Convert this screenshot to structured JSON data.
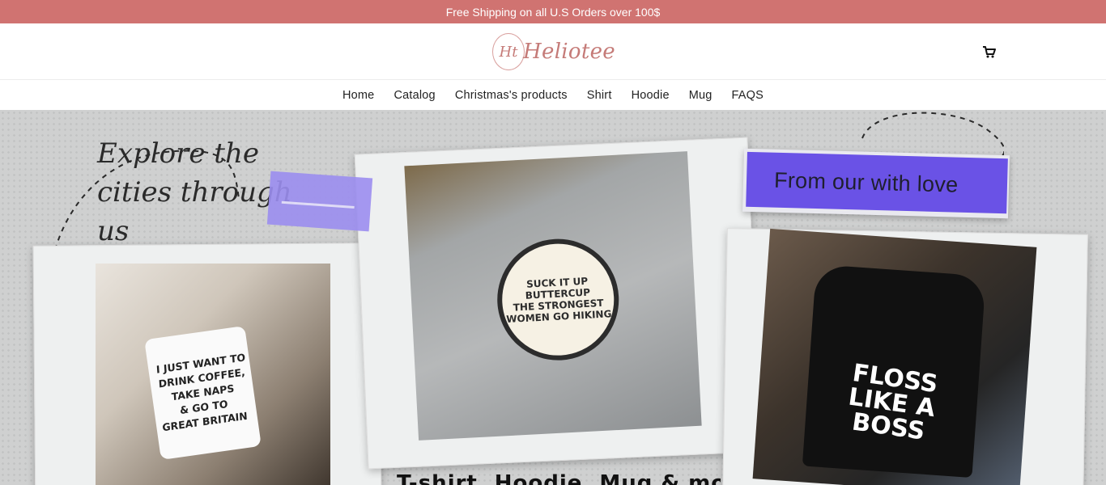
{
  "announcement": {
    "text": "Free Shipping on all U.S Orders over 100$"
  },
  "header": {
    "logo": {
      "mark": "Ht",
      "text": "Heliotee"
    },
    "cart_icon": "cart-icon"
  },
  "nav": {
    "items": [
      {
        "label": "Home"
      },
      {
        "label": "Catalog"
      },
      {
        "label": "Christmas's products"
      },
      {
        "label": "Shirt"
      },
      {
        "label": "Hoodie"
      },
      {
        "label": "Mug"
      },
      {
        "label": "FAQS"
      }
    ]
  },
  "hero": {
    "script_heading": "Explore the cities through us",
    "love_tag": "From our with love",
    "mug_print": "I JUST WANT TO\nDRINK COFFEE,\nTAKE NAPS\n& GO TO\nGREAT BRITAIN",
    "hoodie_print": "SUCK IT UP\nBUTTERCUP\nTHE STRONGEST\nWOMEN GO HIKING",
    "tee_print": "FLOSS\nLIKE A\nBOSS",
    "caption": "T-shirt, Hoodie, Mug & more"
  },
  "colors": {
    "announcement_bg": "#d07371",
    "brand": "#c57b78",
    "hero_bg": "#cfd0d0",
    "love_tag_bg": "#6a52e6"
  }
}
